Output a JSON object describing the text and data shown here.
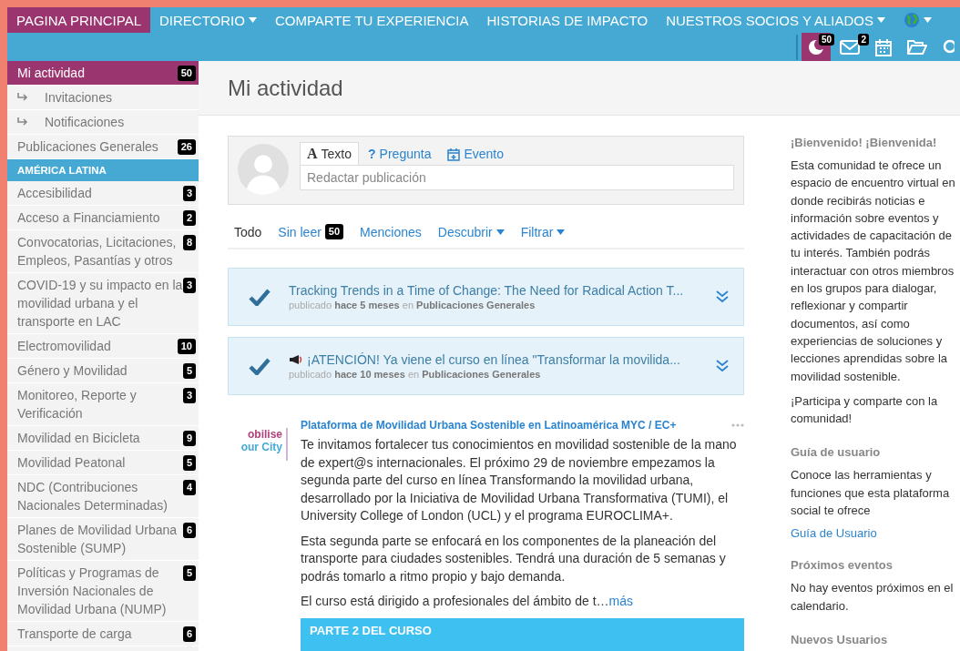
{
  "nav": {
    "items": [
      {
        "label": "PAGINA PRINCIPAL",
        "selected": true,
        "dropdown": false
      },
      {
        "label": "DIRECTORIO",
        "selected": false,
        "dropdown": true
      },
      {
        "label": "COMPARTE TU EXPERIENCIA",
        "selected": false,
        "dropdown": false
      },
      {
        "label": "HISTORIAS DE IMPACTO",
        "selected": false,
        "dropdown": false
      },
      {
        "label": "NUESTROS SOCIOS Y ALIADOS",
        "selected": false,
        "dropdown": true
      }
    ],
    "tools": [
      {
        "kind": "activity",
        "badge": "50",
        "selected": true
      },
      {
        "kind": "mail",
        "badge": "2",
        "selected": false
      },
      {
        "kind": "calendar",
        "selected": false
      },
      {
        "kind": "folder",
        "selected": false
      },
      {
        "kind": "search",
        "selected": false
      }
    ]
  },
  "sidebar": {
    "items": [
      {
        "kind": "link",
        "label": "Mi actividad",
        "count": "50",
        "selected": true
      },
      {
        "kind": "sub",
        "label": "Invitaciones",
        "selected": false
      },
      {
        "kind": "sub",
        "label": "Notificaciones",
        "selected": false
      },
      {
        "kind": "link",
        "label": "Publicaciones Generales",
        "count": "26",
        "selected": false
      },
      {
        "kind": "header",
        "label": "AMÉRICA LATINA"
      },
      {
        "kind": "link",
        "label": "Accesibilidad",
        "count": "3",
        "selected": false
      },
      {
        "kind": "link",
        "label": "Acceso a Financiamiento",
        "count": "2",
        "selected": false
      },
      {
        "kind": "link",
        "label": "Convocatorias, Licitaciones, Empleos, Pasantías y otros",
        "count": "8",
        "selected": false
      },
      {
        "kind": "link",
        "label": "COVID-19 y su impacto en la movilidad urbana y el transporte en LAC",
        "count": "3",
        "selected": false
      },
      {
        "kind": "link",
        "label": "Electromovilidad",
        "count": "10",
        "selected": false
      },
      {
        "kind": "link",
        "label": "Género y Movilidad",
        "count": "5",
        "selected": false
      },
      {
        "kind": "link",
        "label": "Monitoreo, Reporte y Verificación",
        "count": "3",
        "selected": false
      },
      {
        "kind": "link",
        "label": "Movilidad en Bicicleta",
        "count": "9",
        "selected": false
      },
      {
        "kind": "link",
        "label": "Movilidad Peatonal",
        "count": "5",
        "selected": false
      },
      {
        "kind": "link",
        "label": "NDC (Contribuciones Nacionales Determinadas)",
        "count": "4",
        "selected": false
      },
      {
        "kind": "link",
        "label": "Planes de Movilidad Urbana Sostenible (SUMP)",
        "count": "6",
        "selected": false
      },
      {
        "kind": "link",
        "label": "Políticas y Programas de Inversión Nacionales de Movilidad Urbana (NUMP)",
        "count": "5",
        "selected": false
      },
      {
        "kind": "link",
        "label": "Transporte de carga",
        "count": "6",
        "selected": false
      }
    ]
  },
  "main": {
    "title": "Mi actividad",
    "composer": {
      "tabs": [
        {
          "kind": "text",
          "icon": "A",
          "label": "Texto",
          "selected": true
        },
        {
          "kind": "question",
          "icon": "?",
          "label": "Pregunta",
          "selected": false
        },
        {
          "kind": "event",
          "label": "Evento",
          "selected": false
        }
      ],
      "placeholder": "Redactar publicación"
    },
    "filters": [
      {
        "label": "Todo",
        "selected": true,
        "dropdown": false
      },
      {
        "label": "Sin leer",
        "count": "50",
        "selected": false,
        "dropdown": false
      },
      {
        "label": "Menciones",
        "selected": false,
        "dropdown": false
      },
      {
        "label": "Descubrir",
        "selected": false,
        "dropdown": true
      },
      {
        "label": "Filtrar",
        "selected": false,
        "dropdown": true
      }
    ],
    "notices": [
      {
        "kind": "post",
        "title": "Tracking Trends in a Time of Change: The Need for Radical Action T...",
        "meta": "publicado **hace 5 meses** en **Publicaciones Generales**"
      },
      {
        "kind": "announcement",
        "title": "¡ATENCIÓN! Ya viene el curso en línea \"Transformar la movilida...",
        "meta": "publicado **hace 10 meses** en **Publicaciones Generales**"
      }
    ],
    "post": {
      "logo": [
        "obilise",
        "our City"
      ],
      "author": "Plataforma de Movilidad Urbana Sostenible en Latinoamérica MYC / EC+",
      "paragraphs": [
        "Te invitamos fortalecer tus conocimientos en movilidad sostenible de la mano de expert@s internacionales. El próximo 29 de noviembre empezamos la segunda parte del curso en línea Transformando la movilidad urbana, desarrollado por la Iniciativa de Movilidad Urbana Transformativa (TUMI), el University College of London (UCL) y el programa EUROCLIMA+.",
        "Esta segunda parte se enfocará en los componentes de la planeación del transporte para ciudades sostenibles. Tendrá una duración de 5 semanas y podrás tomarlo a ritmo propio y bajo demanda."
      ],
      "excerpt": "El curso está dirigido a profesionales del ámbito de t…",
      "more": "más",
      "banner": "PARTE 2 DEL CURSO"
    }
  },
  "aside": [
    {
      "heading": "¡Bienvenido! ¡Bienvenida!",
      "paragraphs": [
        "Esta comunidad te ofrece un espacio de encuentro virtual en donde recibirás noticias e información sobre eventos y actividades de capacitación de tu interés. También podrás interactuar con otros miembros en los grupos para dialogar, reflexionar y compartir documentos, así como experiencias de soluciones y lecciones aprendidas sobre la movilidad sostenible.",
        "¡Participa y comparte con la comunidad!"
      ]
    },
    {
      "heading": "Guía de usuario",
      "paragraphs": [
        "Conoce las herramientas y funciones que esta plataforma social te ofrece"
      ],
      "link": "Guía de Usuario"
    },
    {
      "heading": "Próximos eventos",
      "paragraphs": [
        "No hay eventos próximos en el calendario."
      ]
    },
    {
      "heading": "Nuevos Usuarios"
    }
  ]
}
